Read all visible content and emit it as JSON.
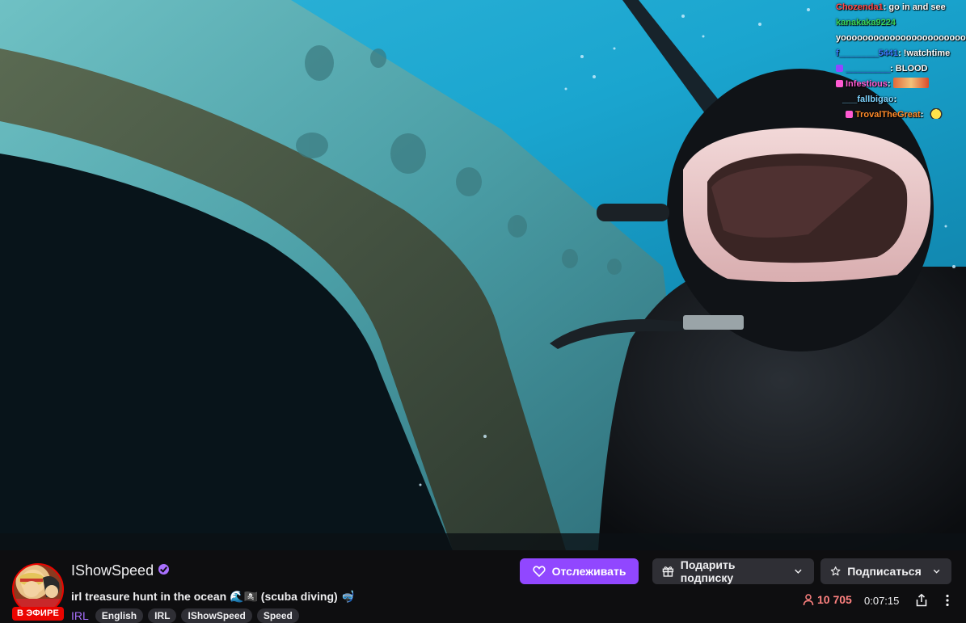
{
  "chat": {
    "lines": [
      {
        "user": "Chozenda1",
        "user_color": "#ff4a4a",
        "msg": ": go in and see"
      },
      {
        "user": "kanakaka9224",
        "user_color": "#3ad65a",
        "msg": ""
      },
      {
        "user": "",
        "user_color": "#ffffff",
        "msg": "yooooooooooooooooooooooooooo"
      },
      {
        "user": "f________5441",
        "user_color": "#3a7dff",
        "msg": ": !watchtime"
      },
      {
        "user": "_________",
        "user_color": "#4a6bff",
        "msg": ": BLOOD"
      },
      {
        "user": "Infestious",
        "user_color": "#ff5ad2",
        "msg": ":"
      },
      {
        "user": "___fallbigao",
        "user_color": "#7fd4ff",
        "msg": ":"
      },
      {
        "user": "TrovalTheGreat",
        "user_color": "#ff8a2a",
        "msg": ":"
      }
    ]
  },
  "channel": {
    "name": "IShowSpeed",
    "live_label": "В ЭФИРЕ",
    "title": "irl treasure hunt in the ocean 🌊🏴‍☠️ (scuba diving) 🤿",
    "category": "IRL",
    "tags": [
      "English",
      "IRL",
      "IShowSpeed",
      "Speed"
    ]
  },
  "actions": {
    "follow_label": "Отслеживать",
    "gift_label": "Подарить подписку",
    "subscribe_label": "Подписаться"
  },
  "stats": {
    "viewers": "10 705",
    "uptime": "0:07:15"
  },
  "colors": {
    "accent": "#9147ff",
    "live": "#eb0400",
    "viewers": "#ff8280"
  }
}
